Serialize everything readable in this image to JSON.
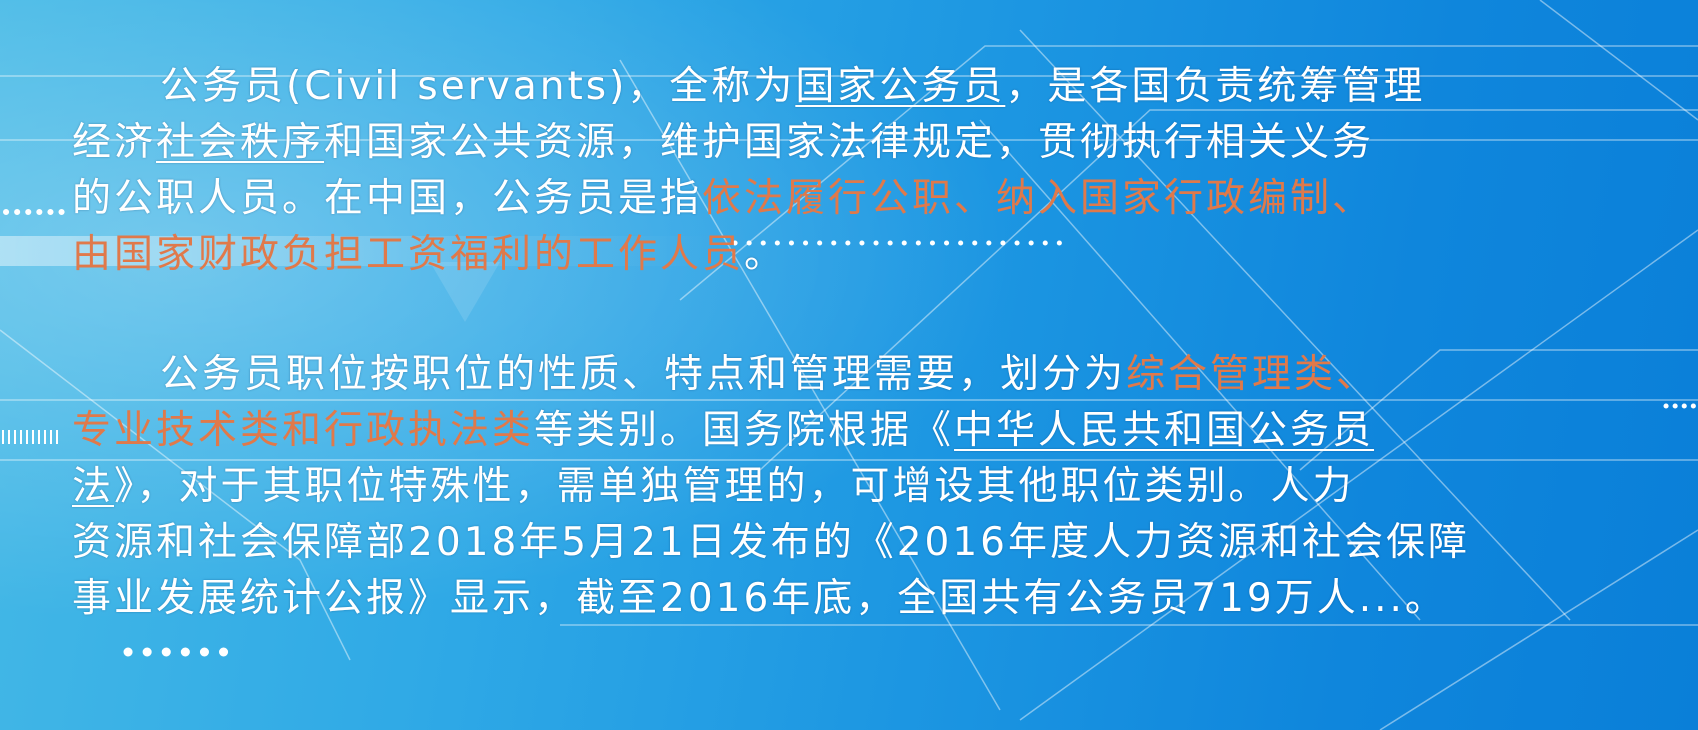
{
  "colors": {
    "text": "#ffffff",
    "highlight": "#e0794a",
    "background_start": "#45b9e6",
    "background_end": "#0a7fd8"
  },
  "paragraphs": [
    {
      "lines": [
        [
          {
            "text": "公务员(Civil servants)，全称为",
            "style": "plain"
          },
          {
            "text": "国家公务员",
            "style": "underline"
          },
          {
            "text": "，是各国负责统筹管理",
            "style": "plain"
          }
        ],
        [
          {
            "text": "经济",
            "style": "plain"
          },
          {
            "text": "社会秩序",
            "style": "underline"
          },
          {
            "text": "和国家公共资源，维护国家法律规定，贯彻执行相关义务",
            "style": "plain"
          }
        ],
        [
          {
            "text": "的公职人员。在中国，公务员是指",
            "style": "plain"
          },
          {
            "text": "依法履行公职、纳入国家行政编制、",
            "style": "highlight"
          }
        ],
        [
          {
            "text": "由国家财政负担工资福利的工作人员",
            "style": "highlight"
          },
          {
            "text": "。",
            "style": "plain"
          }
        ]
      ]
    },
    {
      "lines": [
        [
          {
            "text": "公务员职位按职位的性质、特点和管理需要，划分为",
            "style": "plain"
          },
          {
            "text": "综合管理类、",
            "style": "highlight"
          }
        ],
        [
          {
            "text": "专业技术类和行政执法类",
            "style": "highlight"
          },
          {
            "text": "等类别。国务院根据《",
            "style": "plain"
          },
          {
            "text": "中华人民共和国公务员",
            "style": "underline"
          }
        ],
        [
          {
            "text": "法",
            "style": "underline"
          },
          {
            "text": "》，对于其职位特殊性，需单独管理的，可增设其他职位类别。人力",
            "style": "plain"
          }
        ],
        [
          {
            "text": "资源和社会保障部2018年5月21日发布的《2016年度人力资源和社会保障",
            "style": "plain"
          }
        ],
        [
          {
            "text": "事业发展统计公报》显示，截至2016年底，全国共有公务员719万人...。",
            "style": "plain"
          }
        ]
      ]
    }
  ]
}
